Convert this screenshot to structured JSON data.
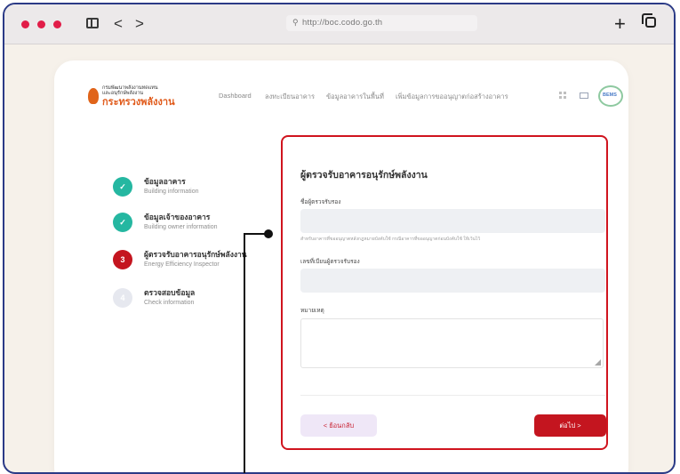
{
  "browser": {
    "url": "http://boc.codo.go.th",
    "back_icon": "<",
    "forward_icon": ">",
    "new_tab_icon": "+",
    "colors": {
      "traffic_light": "#e11d48",
      "frame_border": "#2b3a86"
    }
  },
  "header": {
    "logo_line1": "กรมพัฒนาพลังงานทดแทน",
    "logo_line2": "และอนุรักษ์พลังงาน",
    "logo_line3": "กระทรวงพลังงาน",
    "menu": [
      "Dashboard",
      "ลงทะเบียนอาคาร",
      "ข้อมูลอาคารในพื้นที่",
      "เพิ่มข้อมูลการขออนุญาตก่อสร้างอาคาร"
    ],
    "badge_text": "BEMS"
  },
  "steps": [
    {
      "number": "✓",
      "title": "ข้อมูลอาคาร",
      "subtitle": "Building information",
      "state": "done"
    },
    {
      "number": "✓",
      "title": "ข้อมูลเจ้าของอาคาร",
      "subtitle": "Building owner information",
      "state": "done"
    },
    {
      "number": "3",
      "title": "ผู้ตรวจรับอาคารอนุรักษ์พลังงาน",
      "subtitle": "Energy Efficiency Inspector",
      "state": "active"
    },
    {
      "number": "4",
      "title": "ตรวจสอบข้อมูล",
      "subtitle": "Check information",
      "state": "pending"
    }
  ],
  "form": {
    "title": "ผู้ตรวจรับอาคารอนุรักษ์พลังงาน",
    "field1_label": "ชื่อผู้ตรวจรับรอง",
    "hint": "สำหรับอาคารที่ขออนุญาตหลังกฎหมายบังคับใช้ กรณีอาคารที่ขออนุญาตก่อนบังคับใช้ ให้เว้นไว้",
    "field2_label": "เลขที่เบียนผู้ตรวจรับรอง",
    "field3_label": "หมายเหตุ",
    "back_label": "<   ย้อนกลับ",
    "next_label": "ต่อไป   >"
  },
  "colors": {
    "step_done": "#25b7a1",
    "step_active": "#c4151f",
    "step_pending": "#e6e8ef",
    "highlight": "#d0141e"
  }
}
